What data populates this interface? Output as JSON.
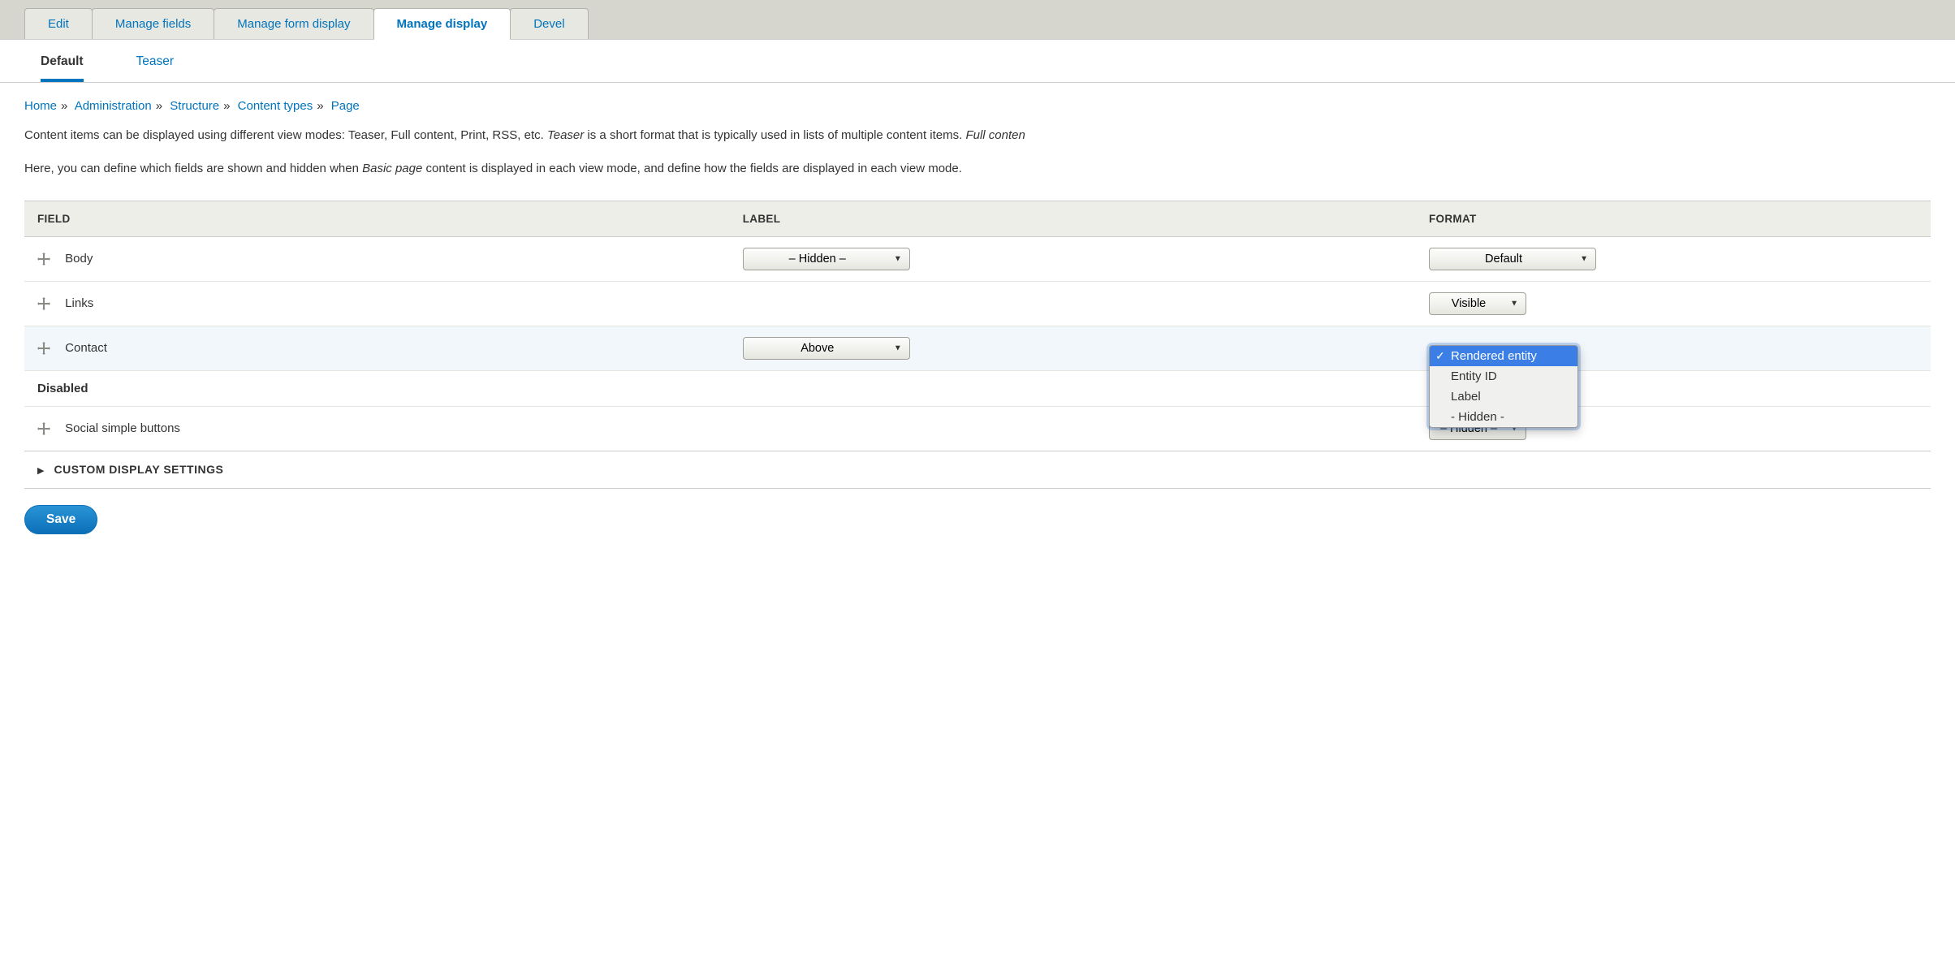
{
  "tabs": {
    "primary": [
      {
        "label": "Edit",
        "active": false
      },
      {
        "label": "Manage fields",
        "active": false
      },
      {
        "label": "Manage form display",
        "active": false
      },
      {
        "label": "Manage display",
        "active": true
      },
      {
        "label": "Devel",
        "active": false
      }
    ],
    "secondary": [
      {
        "label": "Default",
        "active": true
      },
      {
        "label": "Teaser",
        "active": false
      }
    ]
  },
  "breadcrumb": [
    {
      "label": "Home"
    },
    {
      "label": "Administration"
    },
    {
      "label": "Structure"
    },
    {
      "label": "Content types"
    },
    {
      "label": "Page"
    }
  ],
  "help": {
    "p1_a": "Content items can be displayed using different view modes: Teaser, Full content, Print, RSS, etc. ",
    "p1_em1": "Teaser",
    "p1_b": " is a short format that is typically used in lists of multiple content items. ",
    "p1_em2": "Full conten",
    "p2_a": "Here, you can define which fields are shown and hidden when ",
    "p2_em": "Basic page",
    "p2_b": " content is displayed in each view mode, and define how the fields are displayed in each view mode."
  },
  "table": {
    "headers": {
      "field": "FIELD",
      "label": "LABEL",
      "format": "FORMAT"
    },
    "rows": [
      {
        "name": "Body",
        "label_select": "– Hidden –",
        "format_select": "Default",
        "label_width": "wide",
        "format_width": "wide"
      },
      {
        "name": "Links",
        "label_select": "",
        "format_select": "Visible",
        "format_width": ""
      },
      {
        "name": "Contact",
        "label_select": "Above",
        "format_select": "",
        "label_width": "wide",
        "dropdown_open": true,
        "highlighted": true
      }
    ],
    "disabled_label": "Disabled",
    "disabled_rows": [
      {
        "name": "Social simple buttons",
        "format_select": "– Hidden –"
      }
    ],
    "dropdown_options": [
      {
        "label": "Rendered entity",
        "selected": true
      },
      {
        "label": "Entity ID"
      },
      {
        "label": "Label"
      },
      {
        "label": "- Hidden -"
      }
    ]
  },
  "details_label": "CUSTOM DISPLAY SETTINGS",
  "save_label": "Save"
}
